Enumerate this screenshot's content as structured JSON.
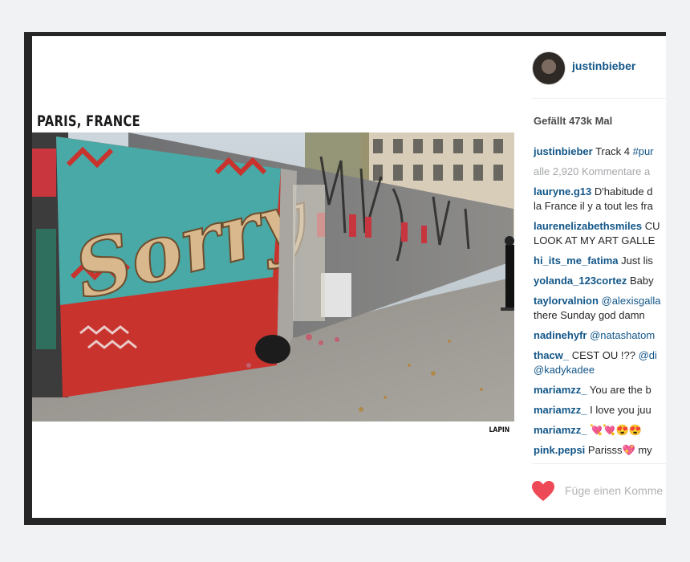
{
  "post": {
    "caption_title": "PARIS, FRANCE",
    "credit": "LAPIN",
    "image_alt_text": "Sorry"
  },
  "sidebar": {
    "username": "justinbieber",
    "likes": "Gefällt 473k Mal",
    "caption": {
      "user": "justinbieber",
      "text": "Track 4",
      "tag": "#pur"
    },
    "view_all": "alle 2,920 Kommentare a",
    "comments": [
      {
        "user": "lauryne.g13",
        "text": "D'habitude d",
        "text2": "la France il y a tout les fra"
      },
      {
        "user": "laurenelizabethsmiles",
        "text": "CU",
        "text2": "LOOK AT MY ART GALLE"
      },
      {
        "user": "hi_its_me_fatima",
        "text": "Just lis"
      },
      {
        "user": "yolanda_123cortez",
        "text": "Baby"
      },
      {
        "user": "taylorvalnion",
        "mention": "@alexisgalla",
        "text2": "there Sunday god damn"
      },
      {
        "user": "nadinehyfr",
        "mention": "@natashatom"
      },
      {
        "user": "thacw_",
        "text": "CEST OU !??",
        "mention": "@di",
        "mention2": "@kadykadee"
      },
      {
        "user": "mariamzz_",
        "text": "You are the b"
      },
      {
        "user": "mariamzz_",
        "text": "I love you juu"
      },
      {
        "user": "mariamzz_",
        "text": "💘💘😍😍"
      },
      {
        "user": "pink.pepsi",
        "text": "Parisss💖 my"
      }
    ],
    "add_comment_placeholder": "Füge einen Komme",
    "heart_icon": "heart-icon",
    "accent_color": "#125688",
    "heart_color": "#ed4956"
  }
}
